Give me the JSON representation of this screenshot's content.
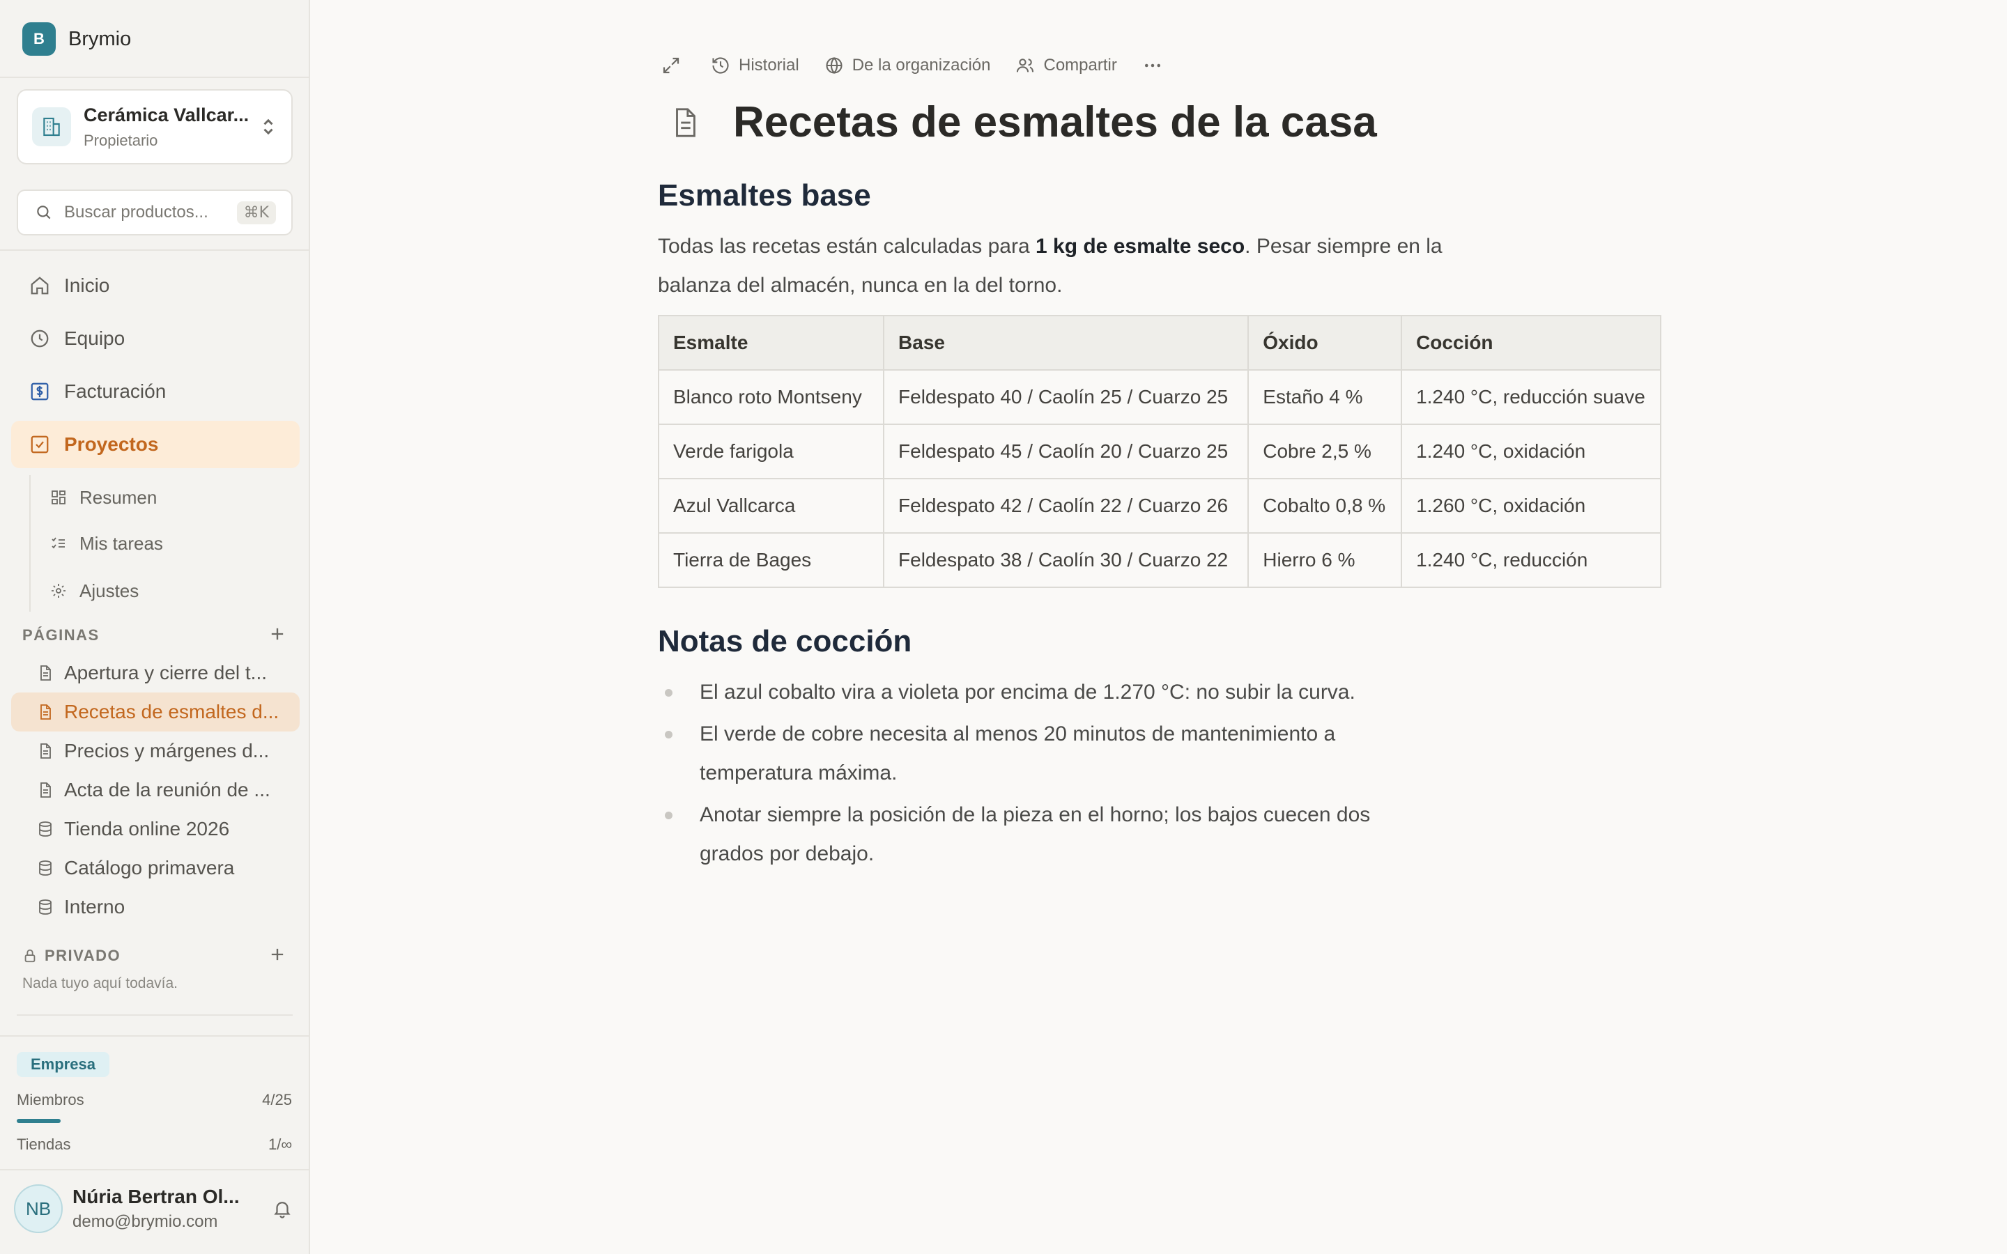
{
  "app": {
    "name": "Brymio",
    "logo_letter": "B"
  },
  "org": {
    "name": "Cerámica Vallcar...",
    "role": "Propietario"
  },
  "search": {
    "placeholder": "Buscar productos...",
    "shortcut": "⌘K"
  },
  "nav": [
    {
      "label": "Inicio",
      "icon": "home-icon"
    },
    {
      "label": "Equipo",
      "icon": "clock-icon"
    },
    {
      "label": "Facturación",
      "icon": "billing-icon"
    },
    {
      "label": "Proyectos",
      "icon": "checkbox-icon",
      "active": true
    }
  ],
  "subnav": [
    {
      "label": "Resumen",
      "icon": "grid-icon"
    },
    {
      "label": "Mis tareas",
      "icon": "checklist-icon"
    },
    {
      "label": "Ajustes",
      "icon": "gear-icon"
    }
  ],
  "pages_section": {
    "title": "PÁGINAS"
  },
  "pages": [
    {
      "label": "Apertura y cierre del t...",
      "icon": "page-icon"
    },
    {
      "label": "Recetas de esmaltes d...",
      "icon": "page-icon",
      "active": true
    },
    {
      "label": "Precios y márgenes d...",
      "icon": "page-icon"
    },
    {
      "label": "Acta de la reunión de ...",
      "icon": "page-icon"
    },
    {
      "label": "Tienda online 2026",
      "icon": "database-icon"
    },
    {
      "label": "Catálogo primavera",
      "icon": "database-icon"
    },
    {
      "label": "Interno",
      "icon": "database-icon"
    }
  ],
  "private_section": {
    "title": "PRIVADO",
    "empty": "Nada tuyo aquí todavía."
  },
  "plan": {
    "badge": "Empresa",
    "members_label": "Miembros",
    "members_value": "4/25",
    "members_fraction": 0.16,
    "stores_label": "Tiendas",
    "stores_value": "1/∞"
  },
  "user": {
    "initials": "NB",
    "name": "Núria Bertran Ol...",
    "email": "demo@brymio.com"
  },
  "toolbar": {
    "history": "Historial",
    "org": "De la organización",
    "share": "Compartir"
  },
  "doc": {
    "title": "Recetas de esmaltes de la casa",
    "section1": "Esmaltes base",
    "intro_before": "Todas las recetas están calculadas para ",
    "intro_bold": "1 kg de esmalte seco",
    "intro_after": ". Pesar siempre en la balanza del almacén, nunca en la del torno.",
    "table": {
      "headers": [
        "Esmalte",
        "Base",
        "Óxido",
        "Cocción"
      ],
      "rows": [
        [
          "Blanco roto Montseny",
          "Feldespato 40 / Caolín 25 / Cuarzo 25",
          "Estaño 4 %",
          "1.240 °C, reducción suave"
        ],
        [
          "Verde farigola",
          "Feldespato 45 / Caolín 20 / Cuarzo 25",
          "Cobre 2,5 %",
          "1.240 °C, oxidación"
        ],
        [
          "Azul Vallcarca",
          "Feldespato 42 / Caolín 22 / Cuarzo 26",
          "Cobalto 0,8 %",
          "1.260 °C, oxidación"
        ],
        [
          "Tierra de Bages",
          "Feldespato 38 / Caolín 30 / Cuarzo 22",
          "Hierro 6 %",
          "1.240 °C, reducción"
        ]
      ]
    },
    "section2": "Notas de cocción",
    "notes": [
      "El azul cobalto vira a violeta por encima de 1.270 °C: no subir la curva.",
      "El verde de cobre necesita al menos 20 minutos de mantenimiento a temperatura máxima.",
      "Anotar siempre la posición de la pieza en el horno; los bajos cuecen dos grados por debajo."
    ]
  },
  "colors": {
    "accent": "#c2671e",
    "active_bg": "#fdecd8",
    "brand": "#2f7f8f"
  }
}
